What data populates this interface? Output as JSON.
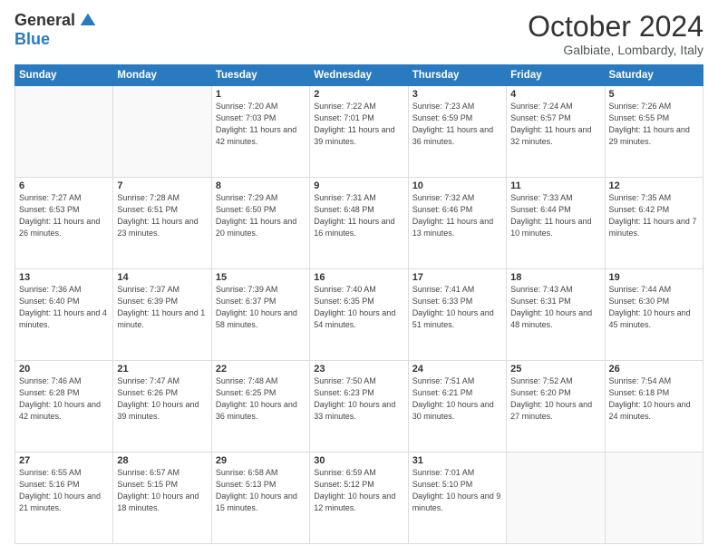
{
  "header": {
    "logo_general": "General",
    "logo_blue": "Blue",
    "month_title": "October 2024",
    "location": "Galbiate, Lombardy, Italy"
  },
  "days_of_week": [
    "Sunday",
    "Monday",
    "Tuesday",
    "Wednesday",
    "Thursday",
    "Friday",
    "Saturday"
  ],
  "weeks": [
    [
      {
        "day": "",
        "sunrise": "",
        "sunset": "",
        "daylight": ""
      },
      {
        "day": "",
        "sunrise": "",
        "sunset": "",
        "daylight": ""
      },
      {
        "day": "1",
        "sunrise": "Sunrise: 7:20 AM",
        "sunset": "Sunset: 7:03 PM",
        "daylight": "Daylight: 11 hours and 42 minutes."
      },
      {
        "day": "2",
        "sunrise": "Sunrise: 7:22 AM",
        "sunset": "Sunset: 7:01 PM",
        "daylight": "Daylight: 11 hours and 39 minutes."
      },
      {
        "day": "3",
        "sunrise": "Sunrise: 7:23 AM",
        "sunset": "Sunset: 6:59 PM",
        "daylight": "Daylight: 11 hours and 36 minutes."
      },
      {
        "day": "4",
        "sunrise": "Sunrise: 7:24 AM",
        "sunset": "Sunset: 6:57 PM",
        "daylight": "Daylight: 11 hours and 32 minutes."
      },
      {
        "day": "5",
        "sunrise": "Sunrise: 7:26 AM",
        "sunset": "Sunset: 6:55 PM",
        "daylight": "Daylight: 11 hours and 29 minutes."
      }
    ],
    [
      {
        "day": "6",
        "sunrise": "Sunrise: 7:27 AM",
        "sunset": "Sunset: 6:53 PM",
        "daylight": "Daylight: 11 hours and 26 minutes."
      },
      {
        "day": "7",
        "sunrise": "Sunrise: 7:28 AM",
        "sunset": "Sunset: 6:51 PM",
        "daylight": "Daylight: 11 hours and 23 minutes."
      },
      {
        "day": "8",
        "sunrise": "Sunrise: 7:29 AM",
        "sunset": "Sunset: 6:50 PM",
        "daylight": "Daylight: 11 hours and 20 minutes."
      },
      {
        "day": "9",
        "sunrise": "Sunrise: 7:31 AM",
        "sunset": "Sunset: 6:48 PM",
        "daylight": "Daylight: 11 hours and 16 minutes."
      },
      {
        "day": "10",
        "sunrise": "Sunrise: 7:32 AM",
        "sunset": "Sunset: 6:46 PM",
        "daylight": "Daylight: 11 hours and 13 minutes."
      },
      {
        "day": "11",
        "sunrise": "Sunrise: 7:33 AM",
        "sunset": "Sunset: 6:44 PM",
        "daylight": "Daylight: 11 hours and 10 minutes."
      },
      {
        "day": "12",
        "sunrise": "Sunrise: 7:35 AM",
        "sunset": "Sunset: 6:42 PM",
        "daylight": "Daylight: 11 hours and 7 minutes."
      }
    ],
    [
      {
        "day": "13",
        "sunrise": "Sunrise: 7:36 AM",
        "sunset": "Sunset: 6:40 PM",
        "daylight": "Daylight: 11 hours and 4 minutes."
      },
      {
        "day": "14",
        "sunrise": "Sunrise: 7:37 AM",
        "sunset": "Sunset: 6:39 PM",
        "daylight": "Daylight: 11 hours and 1 minute."
      },
      {
        "day": "15",
        "sunrise": "Sunrise: 7:39 AM",
        "sunset": "Sunset: 6:37 PM",
        "daylight": "Daylight: 10 hours and 58 minutes."
      },
      {
        "day": "16",
        "sunrise": "Sunrise: 7:40 AM",
        "sunset": "Sunset: 6:35 PM",
        "daylight": "Daylight: 10 hours and 54 minutes."
      },
      {
        "day": "17",
        "sunrise": "Sunrise: 7:41 AM",
        "sunset": "Sunset: 6:33 PM",
        "daylight": "Daylight: 10 hours and 51 minutes."
      },
      {
        "day": "18",
        "sunrise": "Sunrise: 7:43 AM",
        "sunset": "Sunset: 6:31 PM",
        "daylight": "Daylight: 10 hours and 48 minutes."
      },
      {
        "day": "19",
        "sunrise": "Sunrise: 7:44 AM",
        "sunset": "Sunset: 6:30 PM",
        "daylight": "Daylight: 10 hours and 45 minutes."
      }
    ],
    [
      {
        "day": "20",
        "sunrise": "Sunrise: 7:46 AM",
        "sunset": "Sunset: 6:28 PM",
        "daylight": "Daylight: 10 hours and 42 minutes."
      },
      {
        "day": "21",
        "sunrise": "Sunrise: 7:47 AM",
        "sunset": "Sunset: 6:26 PM",
        "daylight": "Daylight: 10 hours and 39 minutes."
      },
      {
        "day": "22",
        "sunrise": "Sunrise: 7:48 AM",
        "sunset": "Sunset: 6:25 PM",
        "daylight": "Daylight: 10 hours and 36 minutes."
      },
      {
        "day": "23",
        "sunrise": "Sunrise: 7:50 AM",
        "sunset": "Sunset: 6:23 PM",
        "daylight": "Daylight: 10 hours and 33 minutes."
      },
      {
        "day": "24",
        "sunrise": "Sunrise: 7:51 AM",
        "sunset": "Sunset: 6:21 PM",
        "daylight": "Daylight: 10 hours and 30 minutes."
      },
      {
        "day": "25",
        "sunrise": "Sunrise: 7:52 AM",
        "sunset": "Sunset: 6:20 PM",
        "daylight": "Daylight: 10 hours and 27 minutes."
      },
      {
        "day": "26",
        "sunrise": "Sunrise: 7:54 AM",
        "sunset": "Sunset: 6:18 PM",
        "daylight": "Daylight: 10 hours and 24 minutes."
      }
    ],
    [
      {
        "day": "27",
        "sunrise": "Sunrise: 6:55 AM",
        "sunset": "Sunset: 5:16 PM",
        "daylight": "Daylight: 10 hours and 21 minutes."
      },
      {
        "day": "28",
        "sunrise": "Sunrise: 6:57 AM",
        "sunset": "Sunset: 5:15 PM",
        "daylight": "Daylight: 10 hours and 18 minutes."
      },
      {
        "day": "29",
        "sunrise": "Sunrise: 6:58 AM",
        "sunset": "Sunset: 5:13 PM",
        "daylight": "Daylight: 10 hours and 15 minutes."
      },
      {
        "day": "30",
        "sunrise": "Sunrise: 6:59 AM",
        "sunset": "Sunset: 5:12 PM",
        "daylight": "Daylight: 10 hours and 12 minutes."
      },
      {
        "day": "31",
        "sunrise": "Sunrise: 7:01 AM",
        "sunset": "Sunset: 5:10 PM",
        "daylight": "Daylight: 10 hours and 9 minutes."
      },
      {
        "day": "",
        "sunrise": "",
        "sunset": "",
        "daylight": ""
      },
      {
        "day": "",
        "sunrise": "",
        "sunset": "",
        "daylight": ""
      }
    ]
  ]
}
